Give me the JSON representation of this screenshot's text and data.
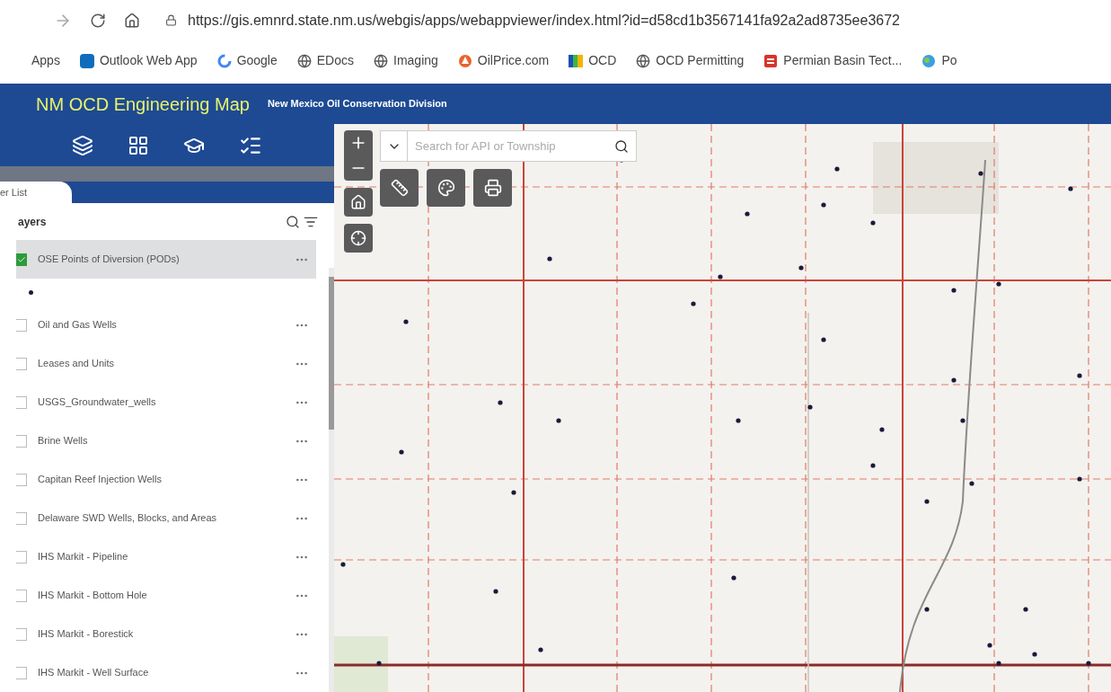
{
  "browser": {
    "url": "https://gis.emnrd.state.nm.us/webgis/apps/webappviewer/index.html?id=d58cd1b3567141fa92a2ad8735ee3672"
  },
  "bookmarks": [
    {
      "label": "Apps",
      "kind": "plain"
    },
    {
      "label": "Outlook Web App",
      "kind": "outlook"
    },
    {
      "label": "Google",
      "kind": "google"
    },
    {
      "label": "EDocs",
      "kind": "globe"
    },
    {
      "label": "Imaging",
      "kind": "globe"
    },
    {
      "label": "OilPrice.com",
      "kind": "drop"
    },
    {
      "label": "OCD",
      "kind": "bars"
    },
    {
      "label": "OCD Permitting",
      "kind": "globe"
    },
    {
      "label": "Permian Basin Tect...",
      "kind": "doc"
    },
    {
      "label": "Po",
      "kind": "ball"
    }
  ],
  "app": {
    "title": "NM OCD Engineering Map",
    "subtitle": "New Mexico Oil Conservation Division"
  },
  "sidebar": {
    "tab_label": "er List",
    "panel_title": "ayers",
    "layers": [
      {
        "label": "OSE Points of Diversion (PODs)",
        "checked": true,
        "selected": true,
        "expanded": true
      },
      {
        "label": "Oil and Gas Wells",
        "checked": false,
        "selected": false,
        "expanded": false
      },
      {
        "label": "Leases and Units",
        "checked": false,
        "selected": false,
        "expanded": false
      },
      {
        "label": "USGS_Groundwater_wells",
        "checked": false,
        "selected": false,
        "expanded": false
      },
      {
        "label": "Brine Wells",
        "checked": false,
        "selected": false,
        "expanded": false
      },
      {
        "label": "Capitan Reef Injection Wells",
        "checked": false,
        "selected": false,
        "expanded": false
      },
      {
        "label": "Delaware SWD Wells, Blocks, and Areas",
        "checked": false,
        "selected": false,
        "expanded": false
      },
      {
        "label": "IHS Markit - Pipeline",
        "checked": false,
        "selected": false,
        "expanded": false
      },
      {
        "label": "IHS Markit - Bottom Hole",
        "checked": false,
        "selected": false,
        "expanded": false
      },
      {
        "label": "IHS Markit - Borestick",
        "checked": false,
        "selected": false,
        "expanded": false
      },
      {
        "label": "IHS Markit - Well Surface",
        "checked": false,
        "selected": false,
        "expanded": false
      }
    ]
  },
  "map": {
    "search": {
      "placeholder": "Search for API or Township"
    }
  }
}
